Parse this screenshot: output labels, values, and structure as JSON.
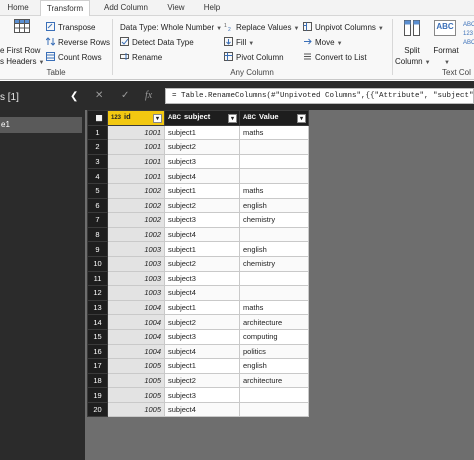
{
  "tabs": [
    {
      "label": "Home",
      "active": false
    },
    {
      "label": "Transform",
      "active": true
    },
    {
      "label": "Add Column",
      "active": false
    },
    {
      "label": "View",
      "active": false
    },
    {
      "label": "Help",
      "active": false
    }
  ],
  "ribbon": {
    "use_first_row_line1": "e First Row",
    "use_first_row_line2": "s Headers",
    "transpose": "Transpose",
    "reverse_rows": "Reverse Rows",
    "count_rows": "Count Rows",
    "table_group": "Table",
    "data_type": "Data Type: Whole Number",
    "detect_data_type": "Detect Data Type",
    "rename": "Rename",
    "replace_values": "Replace Values",
    "fill": "Fill",
    "pivot_column": "Pivot Column",
    "unpivot_columns": "Unpivot Columns",
    "move": "Move",
    "convert_to_list": "Convert to List",
    "any_column_group": "Any Column",
    "split_column_line1": "Split",
    "split_column_line2": "Column",
    "format": "Format",
    "text_column_group": "Text Col",
    "abc_glyph": "ABC",
    "num_glyph": "123"
  },
  "queries": {
    "title": "s [1]",
    "item": "e1"
  },
  "formula": "= Table.RenameColumns(#\"Unpivoted Columns\",{{\"Attribute\", \"subject\"}})",
  "columns": [
    {
      "name": "id",
      "type_icon": "123"
    },
    {
      "name": "subject",
      "type_icon": "ABC"
    },
    {
      "name": "Value",
      "type_icon": "ABC"
    }
  ],
  "rows": [
    [
      "1001",
      "subject1",
      "maths"
    ],
    [
      "1001",
      "subject2",
      ""
    ],
    [
      "1001",
      "subject3",
      ""
    ],
    [
      "1001",
      "subject4",
      ""
    ],
    [
      "1002",
      "subject1",
      "maths"
    ],
    [
      "1002",
      "subject2",
      "english"
    ],
    [
      "1002",
      "subject3",
      "chemistry"
    ],
    [
      "1002",
      "subject4",
      ""
    ],
    [
      "1003",
      "subject1",
      "english"
    ],
    [
      "1003",
      "subject2",
      "chemistry"
    ],
    [
      "1003",
      "subject3",
      ""
    ],
    [
      "1003",
      "subject4",
      ""
    ],
    [
      "1004",
      "subject1",
      "maths"
    ],
    [
      "1004",
      "subject2",
      "architecture"
    ],
    [
      "1004",
      "subject3",
      "computing"
    ],
    [
      "1004",
      "subject4",
      "politics"
    ],
    [
      "1005",
      "subject1",
      "english"
    ],
    [
      "1005",
      "subject2",
      "architecture"
    ],
    [
      "1005",
      "subject3",
      ""
    ],
    [
      "1005",
      "subject4",
      ""
    ]
  ],
  "colors": {
    "selected_column": "#f2c811",
    "dark_pane": "#2b2b2b",
    "grid_background": "#6e6e6e"
  }
}
